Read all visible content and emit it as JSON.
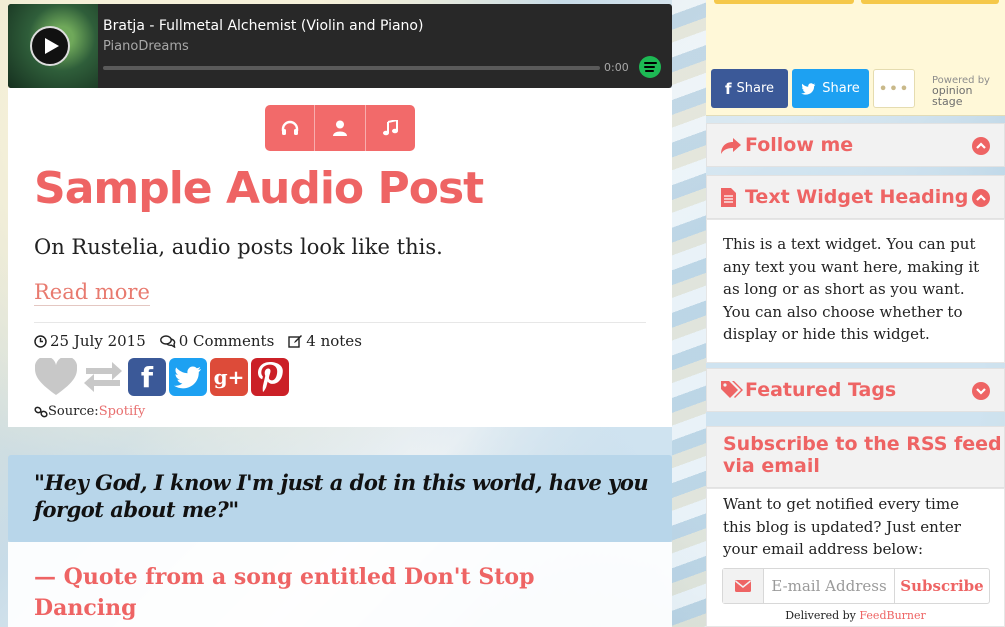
{
  "player": {
    "track_title": "Bratja - Fullmetal Alchemist (Violin and Piano)",
    "artist": "PianoDreams",
    "time": "0:00",
    "progress": 0
  },
  "post": {
    "title": "Sample Audio Post",
    "body": "On Rustelia, audio posts look like this.",
    "read_more": "Read more",
    "date": "25 July 2015",
    "comments": "0 Comments",
    "notes": "4 notes",
    "source_label": "Source:",
    "source_link": "Spotify"
  },
  "quote": {
    "text": "\"Hey God, I know I'm just a dot in this world, have you forgot about me?\"",
    "source": "— Quote from a song entitled Don't Stop Dancing"
  },
  "sidebar": {
    "share_facebook": "Share",
    "share_twitter": "Share",
    "more": "•••",
    "powered_by": "Powered by",
    "opinion_stage": "opinion stage",
    "follow_title": "Follow me",
    "text_widget_title": "Text Widget Heading",
    "text_widget_body": "This is a text widget. You can put any text you want here, making it as long or as short as you want. You can also choose whether to display or hide this widget.",
    "featured_tags_title": "Featured Tags",
    "rss_title": "Subscribe to the RSS feed via email",
    "rss_body": "Want to get notified every time this blog is updated? Just enter your email address below:",
    "email_placeholder": "E-mail Address",
    "subscribe_label": "Subscribe",
    "delivered_by": "Delivered by",
    "feedburner": "FeedBurner"
  },
  "colors": {
    "accent": "#ee6464",
    "quote_bg": "#b8d6ea",
    "player_bg": "#282828",
    "spotify": "#1db954",
    "facebook": "#3b5998",
    "twitter": "#1da1f2",
    "googleplus": "#dd4b39",
    "pinterest": "#cb2027"
  }
}
